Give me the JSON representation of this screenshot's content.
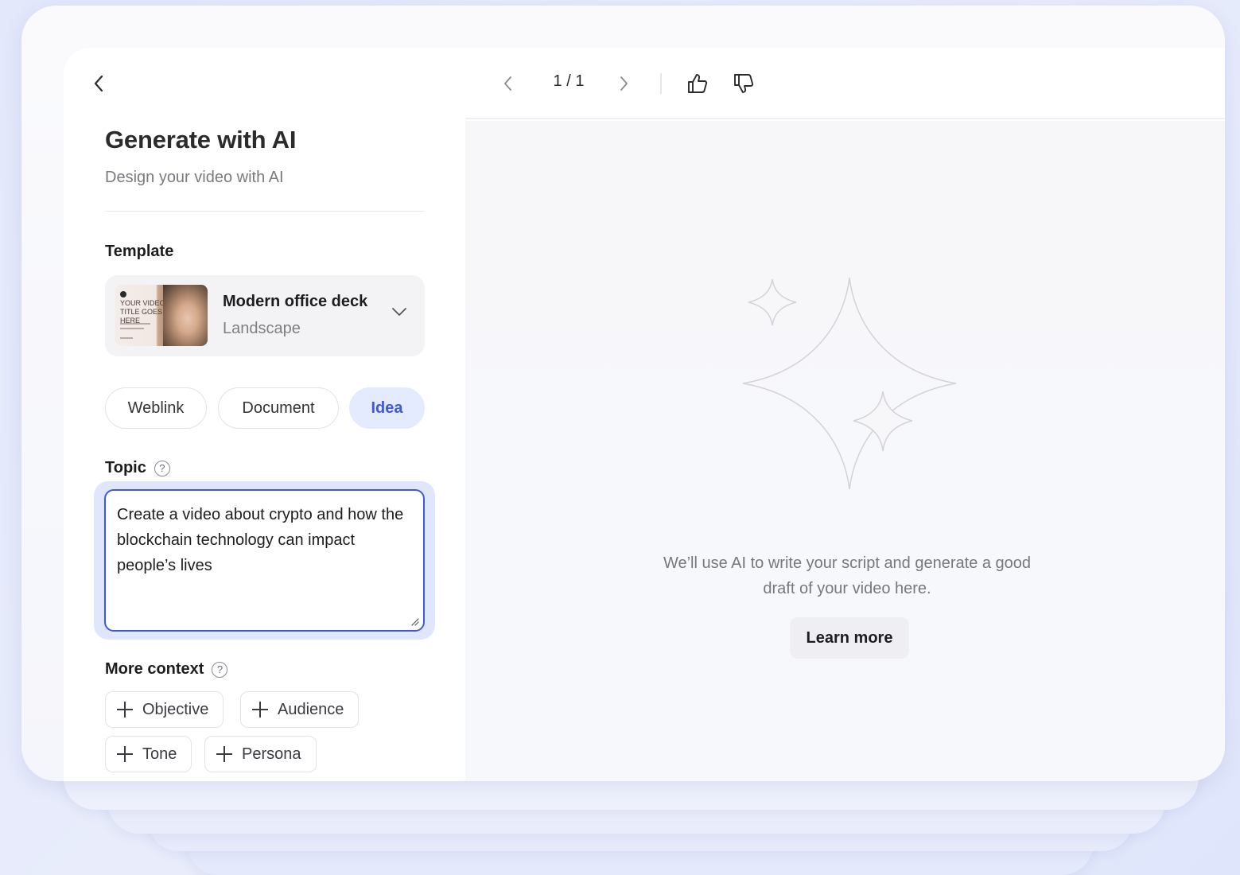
{
  "header": {
    "title": "Generate with AI",
    "subtitle": "Design your video with AI"
  },
  "template": {
    "label": "Template",
    "name": "Modern office deck",
    "orientation": "Landscape",
    "thumbnail_text": "YOUR VIDEO TITLE GOES HERE"
  },
  "source_tabs": [
    {
      "label": "Weblink",
      "active": false
    },
    {
      "label": "Document",
      "active": false
    },
    {
      "label": "Idea",
      "active": true
    }
  ],
  "topic": {
    "label": "Topic",
    "value": "Create a video about crypto and how the blockchain technology can impact people’s lives"
  },
  "more_context": {
    "label": "More context",
    "chips": [
      "Objective",
      "Audience",
      "Tone",
      "Persona"
    ]
  },
  "preview": {
    "page_counter": "1 / 1",
    "empty_message": "We’ll use AI to write your script and generate a good draft of your video here.",
    "learn_more_label": "Learn more"
  },
  "colors": {
    "accent": "#3d5bd9",
    "accent_bg": "#e4ebfe"
  },
  "icons": {
    "back": "chevron-left-icon",
    "prev": "chevron-left-icon",
    "next": "chevron-right-icon",
    "like": "thumbs-up-icon",
    "dislike": "thumbs-down-icon",
    "help": "question-circle-icon",
    "add": "plus-icon",
    "empty_state": "sparkles-icon"
  }
}
